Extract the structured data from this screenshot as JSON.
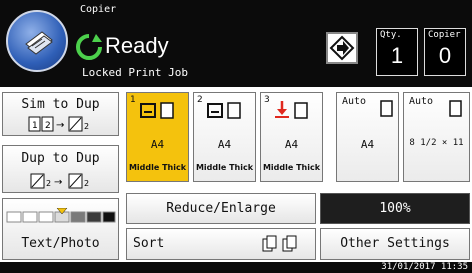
{
  "header": {
    "mode_title": "Copier",
    "status": "Ready",
    "sub_status": "Locked Print Job",
    "qty_label": "Qty.",
    "qty_value": "1",
    "copier_label": "Copier",
    "copier_value": "0"
  },
  "duplex": {
    "sim_label": "Sim to Dup",
    "dup_label": "Dup to Dup",
    "sim_flow": "1 2 → 1/2",
    "dup_flow": "1/2 → 1/2"
  },
  "trays": [
    {
      "number": "1",
      "paper": "A4",
      "type": "Middle Thick",
      "selected": true
    },
    {
      "number": "2",
      "paper": "A4",
      "type": "Middle Thick",
      "selected": false
    },
    {
      "number": "3",
      "paper": "A4",
      "type": "Middle Thick",
      "selected": false
    },
    {
      "auto": "Auto",
      "paper": "A4",
      "type": "",
      "selected": false
    },
    {
      "auto": "Auto",
      "paper": "8 1/2 × 11",
      "type": "",
      "selected": false
    }
  ],
  "density": {
    "label": "Text/Photo"
  },
  "buttons": {
    "reduce_enlarge": "Reduce/Enlarge",
    "ratio": "100%",
    "sort": "Sort",
    "other_settings": "Other Settings"
  },
  "statusbar": {
    "datetime": "31/01/2017 11:35"
  },
  "colors": {
    "selected": "#f4c20d",
    "header": "#0b0b0b",
    "home": "#2f5fb7",
    "ready": "#4cd04c",
    "alert": "#e0281e"
  }
}
